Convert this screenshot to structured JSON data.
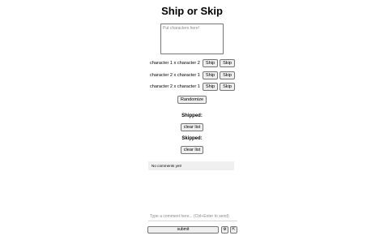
{
  "title": "Ship or Skip",
  "input": {
    "placeholder": "Put characters here!"
  },
  "pairs": [
    {
      "label": "character 1 x character 2",
      "ship": "Ship",
      "skip": "Skip"
    },
    {
      "label": "character 2 x character 1",
      "ship": "Ship",
      "skip": "Skip"
    },
    {
      "label": "character 2 x character 1",
      "ship": "Ship",
      "skip": "Skip"
    }
  ],
  "randomize_label": "Randomize",
  "shipped": {
    "heading": "Shipped:",
    "clear_label": "clear list"
  },
  "skipped": {
    "heading": "Skipped:",
    "clear_label": "clear list"
  },
  "comments": {
    "empty_text": "No comments yet!",
    "placeholder": "Type a comment here... (Ctrl+Enter to send)",
    "submit_label": "submit",
    "settings_icon": "gear-icon",
    "settings_glyph": "⚙",
    "minimize_icon": "collapse-icon",
    "minimize_glyph": "⇱"
  }
}
